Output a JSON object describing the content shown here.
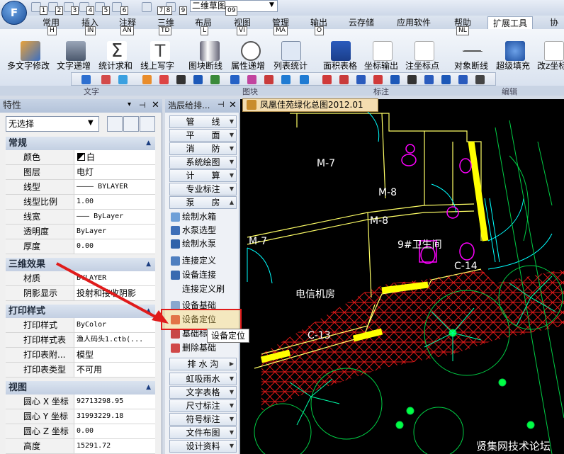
{
  "app": {
    "menu_button": "F",
    "workspace": "二维草图",
    "quick_access_keys": [
      "1",
      "2",
      "3",
      "4",
      "5",
      "6",
      "7",
      "8",
      "9"
    ],
    "workspace_key": "09"
  },
  "tabs": [
    {
      "label": "常用",
      "key": "H"
    },
    {
      "label": "插入",
      "key": "IN"
    },
    {
      "label": "注释",
      "key": "AN"
    },
    {
      "label": "三维",
      "key": "TD"
    },
    {
      "label": "布局",
      "key": "L"
    },
    {
      "label": "视图",
      "key": "VI"
    },
    {
      "label": "管理",
      "key": "MA"
    },
    {
      "label": "输出",
      "key": "O"
    },
    {
      "label": "云存储",
      "key": ""
    },
    {
      "label": "应用软件",
      "key": ""
    },
    {
      "label": "帮助",
      "key": "NL"
    },
    {
      "label": "扩展工具",
      "key": ""
    },
    {
      "label": "协同",
      "key": ""
    }
  ],
  "ribbon": {
    "buttons": [
      "多文字修改",
      "文字递增",
      "统计求和",
      "线上写字",
      "图块断线",
      "属性递增",
      "列表统计",
      "面积表格",
      "坐标输出",
      "注坐标点",
      "对象断线",
      "超级填充",
      "改z坐标"
    ],
    "groups": [
      "文字",
      "图块",
      "标注",
      "编辑"
    ]
  },
  "props": {
    "title": "特性",
    "selection": "无选择",
    "sections": [
      {
        "title": "常规",
        "rows": [
          [
            "颜色",
            "白"
          ],
          [
            "图层",
            "电灯"
          ],
          [
            "线型",
            "———— BYLAYER"
          ],
          [
            "线型比例",
            "1.00"
          ],
          [
            "线宽",
            "——— ByLayer"
          ],
          [
            "透明度",
            "ByLayer"
          ],
          [
            "厚度",
            "0.00"
          ]
        ]
      },
      {
        "title": "三维效果",
        "rows": [
          [
            "材质",
            "BYLAYER"
          ],
          [
            "阴影显示",
            "投射和接收阴影"
          ]
        ]
      },
      {
        "title": "打印样式",
        "rows": [
          [
            "打印样式",
            "ByColor"
          ],
          [
            "打印样式表",
            "渔人码头1.ctb(..."
          ],
          [
            "打印表附...",
            "模型"
          ],
          [
            "打印表类型",
            "不可用"
          ]
        ]
      },
      {
        "title": "视图",
        "rows": [
          [
            "圆心 X 坐标",
            "92713298.95"
          ],
          [
            "圆心 Y 坐标",
            "31993229.18"
          ],
          [
            "圆心 Z 坐标",
            "0.00"
          ],
          [
            "高度",
            "15291.72"
          ]
        ]
      }
    ]
  },
  "tool": {
    "title": "浩辰给排...",
    "cats_top": [
      "管　　线",
      "平　　面",
      "消　　防",
      "系统绘图",
      "计　　算",
      "专业标注",
      "泵　　房"
    ],
    "items": [
      "绘制水箱",
      "水泵选型",
      "绘制水泵",
      "连接定义",
      "设备连接",
      "连接定义刷",
      "设备基础",
      "设备定位",
      "基础标注",
      "删除基础"
    ],
    "cats_bottom": [
      "排 水 沟",
      "虹吸雨水",
      "文字表格",
      "尺寸标注",
      "符号标注",
      "文件布图",
      "设计资料"
    ],
    "tooltip": "设备定位"
  },
  "drawing": {
    "doc_tab": "凤凰佳苑绿化总图2012.01",
    "labels": [
      "M-7",
      "M-8",
      "M-8",
      "M-7",
      "9#卫生间",
      "电信机房",
      "C-14",
      "C-13"
    ],
    "watermark": "贤集网技术论坛"
  },
  "colors": {
    "highlight": "#e01b1b",
    "cad_bg": "#000000",
    "wall": "#ffff00"
  }
}
